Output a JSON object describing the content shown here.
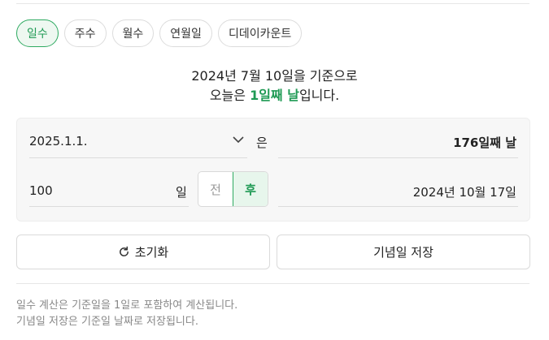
{
  "tabs": [
    {
      "label": "일수",
      "active": true
    },
    {
      "label": "주수",
      "active": false
    },
    {
      "label": "월수",
      "active": false
    },
    {
      "label": "연월일",
      "active": false
    },
    {
      "label": "디데이카운트",
      "active": false
    }
  ],
  "summary": {
    "line1": "2024년 7월 10일을 기준으로",
    "line2_prefix": "오늘은 ",
    "line2_highlight": "1일째 날",
    "line2_suffix": "입니다."
  },
  "calc": {
    "date_value": "2025.1.1.",
    "connector": "은",
    "date_result": "176일째 날",
    "days_value": "100",
    "days_unit": "일",
    "before_label": "전",
    "after_label": "후",
    "after_selected": true,
    "days_result": "2024년 10월 17일"
  },
  "buttons": {
    "reset": "초기화",
    "save": "기념일 저장"
  },
  "notes": [
    "일수 계산은 기준일을 1일로 포함하여 계산됩니다.",
    "기념일 저장은 기준일 날짜로 저장됩니다."
  ],
  "colors": {
    "accent": "#1f9a54",
    "accent_bg": "#eef8f1"
  },
  "icons": {
    "dropdown": "chevron-down-icon",
    "reset": "refresh-icon"
  }
}
